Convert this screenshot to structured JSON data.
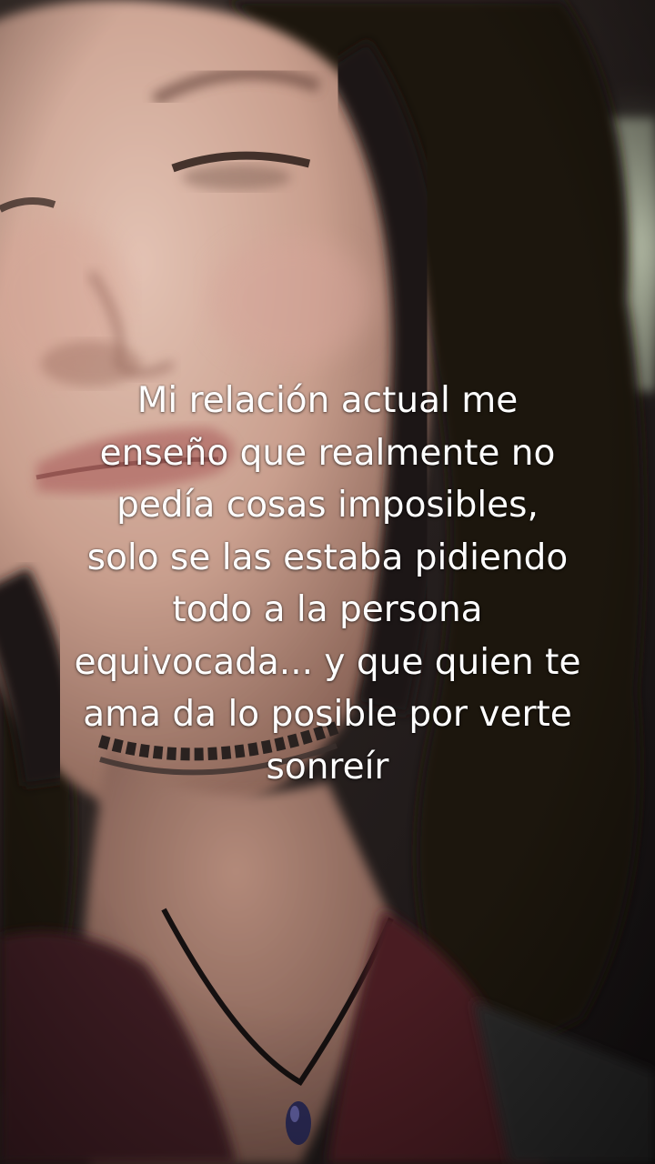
{
  "overlay": {
    "caption_lines": [
      "Mi relación actual me",
      "enseño que realmente no",
      "pedía cosas imposibles,",
      "solo se las estaba pidiendo",
      "todo a la persona",
      "equivocada... y que quien te",
      "ama da lo posible por verte",
      "sonreír"
    ]
  },
  "colors": {
    "caption_text": "#ffffff",
    "hair": "#1c1311",
    "skin": "#c99f8e",
    "background_light": "#cfd8c0",
    "top_garment": "#4a1f24"
  }
}
